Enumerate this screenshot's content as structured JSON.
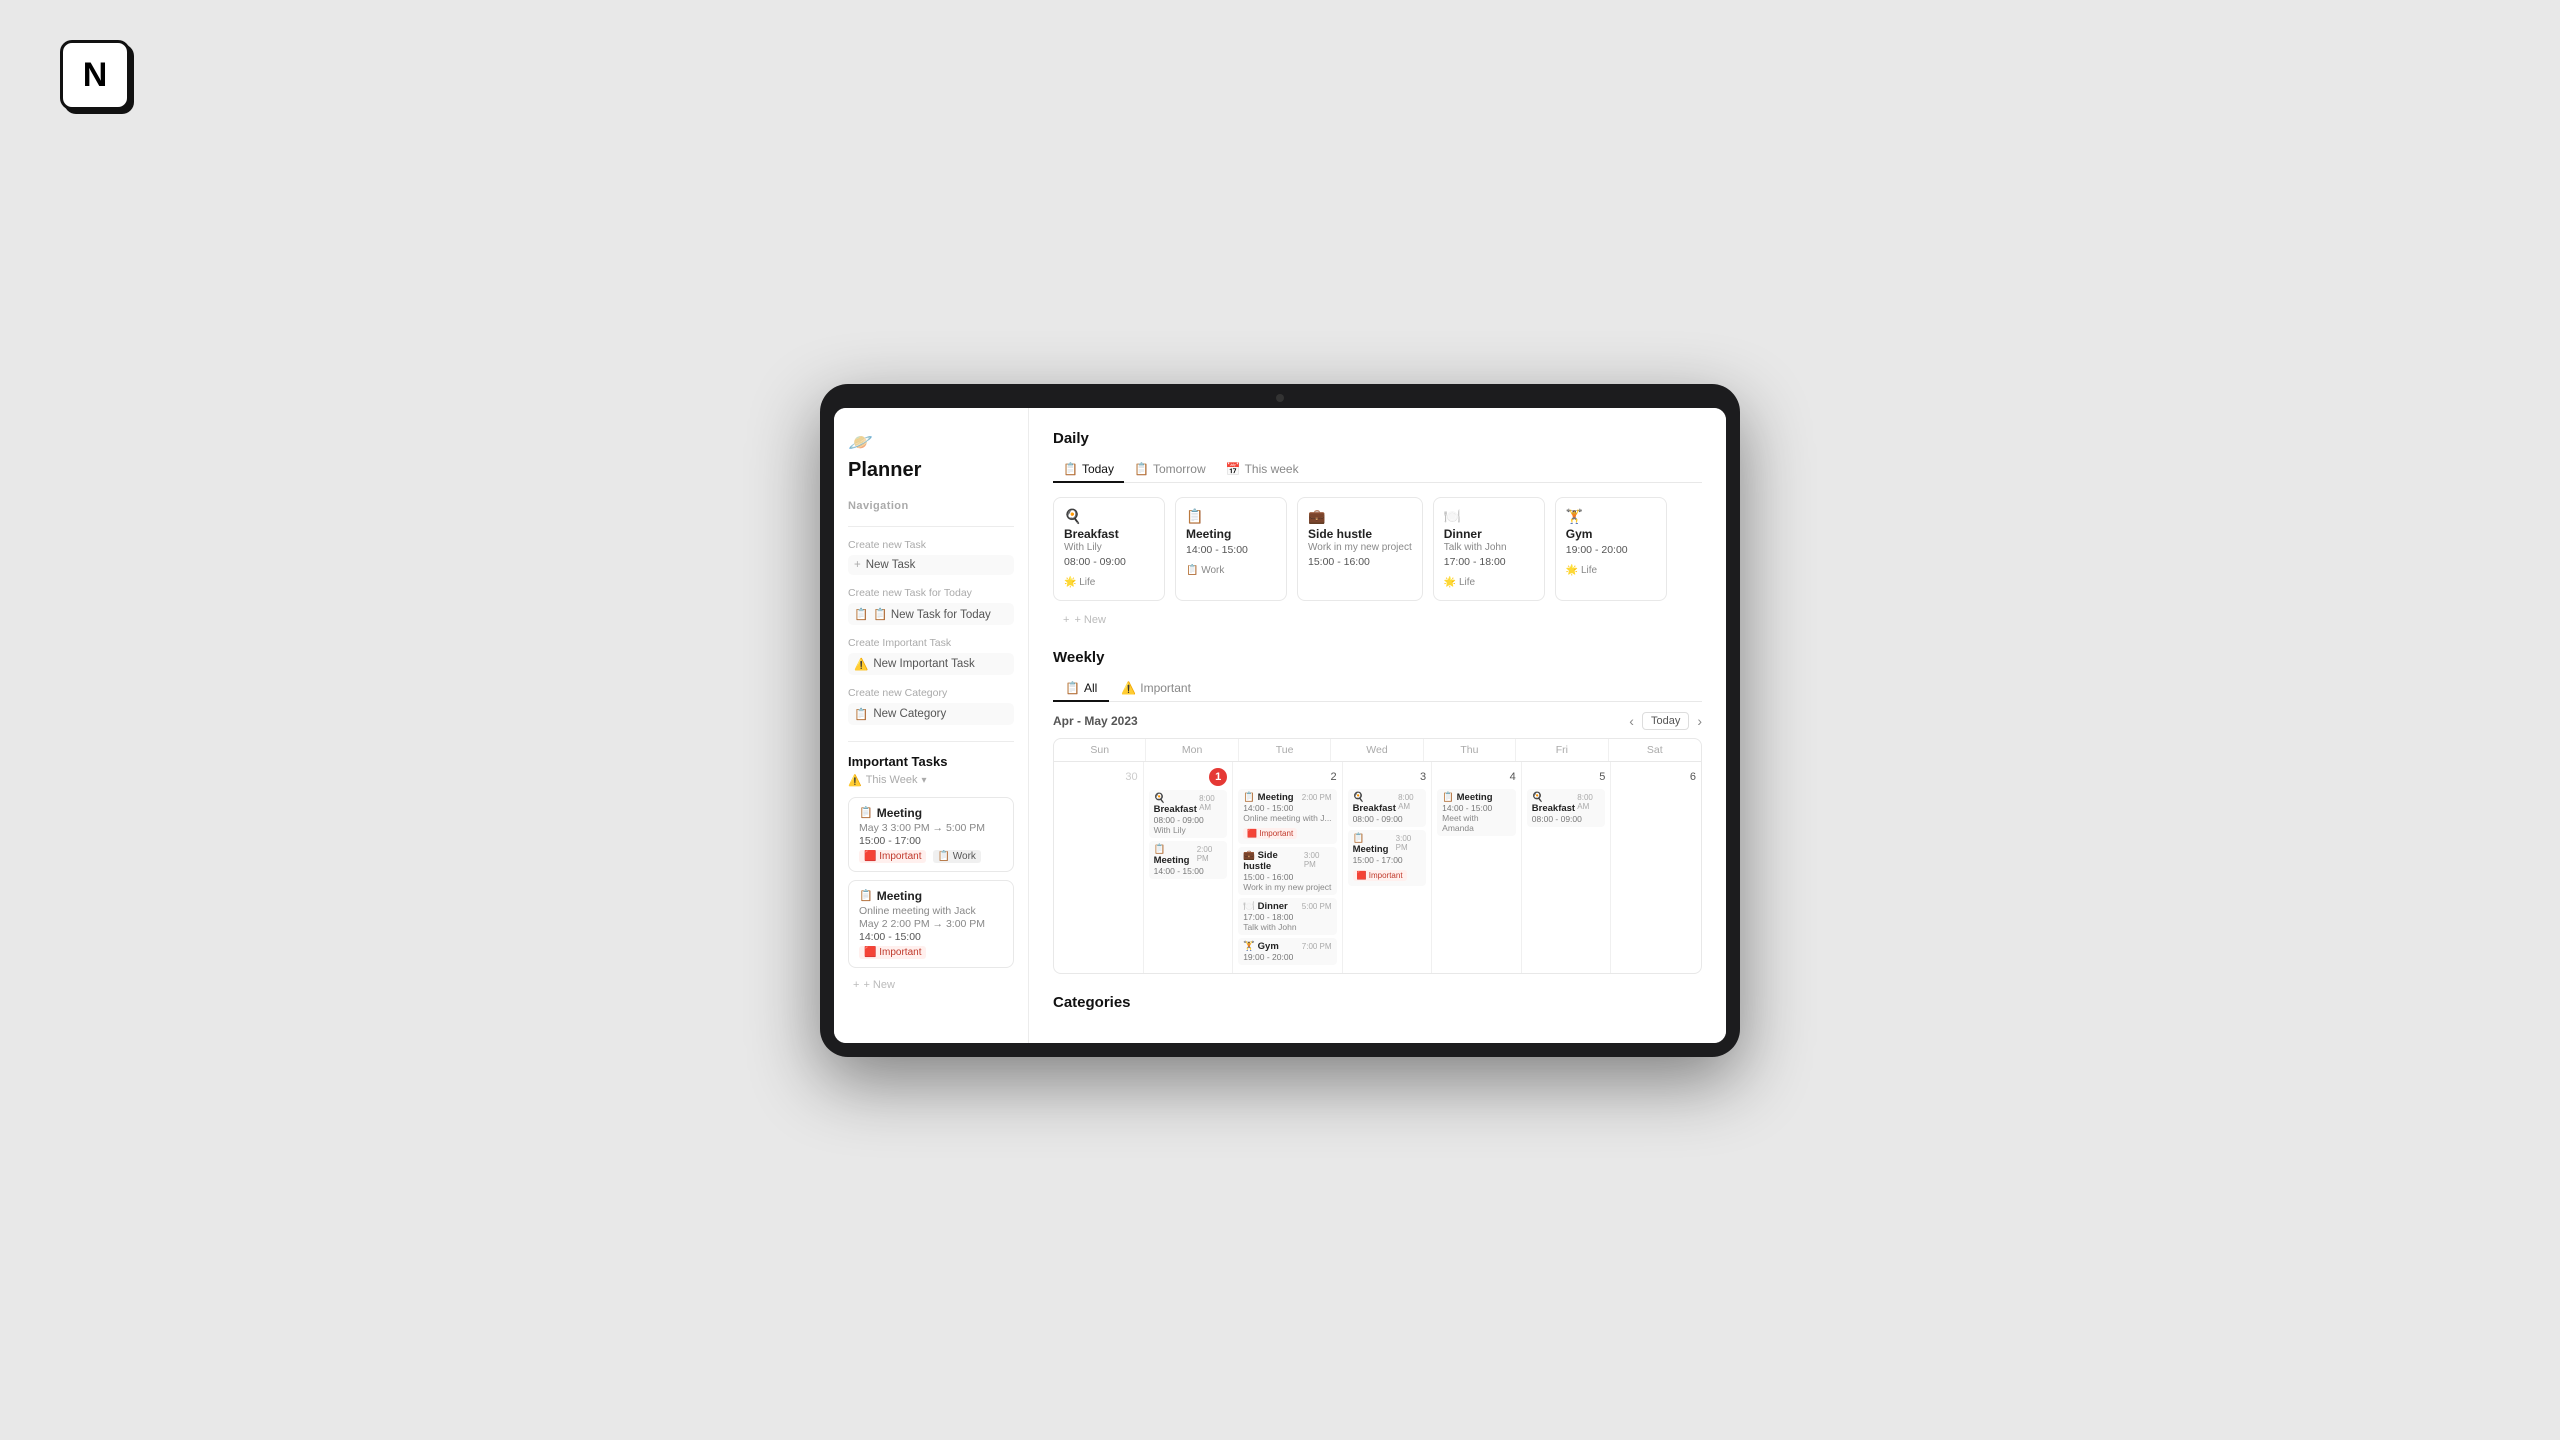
{
  "logo": "N",
  "planner": {
    "icon": "🪐",
    "title": "Planner"
  },
  "navigation": {
    "label": "Navigation"
  },
  "sidebar": {
    "sections": [
      {
        "label": "Create new Task",
        "button": "+ New Task"
      },
      {
        "label": "Create new Task for Today",
        "button": "📋 New Task for Today"
      },
      {
        "label": "Create Important Task",
        "button": "⚠️ New Important Task"
      },
      {
        "label": "Create new Category",
        "button": "📋 New Category"
      }
    ],
    "importantTasksTitle": "Important Tasks",
    "thisWeek": "This Week",
    "tasks": [
      {
        "emoji": "📋",
        "title": "Meeting",
        "date": "May 3 3:00 PM → 5:00 PM",
        "time": "15:00 - 17:00",
        "tags": [
          "Important",
          "Work"
        ]
      },
      {
        "emoji": "📋",
        "title": "Meeting",
        "date": "Online meeting with Jack",
        "date2": "May 2 2:00 PM → 3:00 PM",
        "time": "14:00 - 15:00",
        "tags": [
          "Important"
        ]
      }
    ],
    "newBtn": "+ New"
  },
  "daily": {
    "sectionTitle": "Daily",
    "tabs": [
      {
        "label": "📋 Today",
        "active": true
      },
      {
        "label": "📋 Tomorrow",
        "active": false
      },
      {
        "label": "📅 This week",
        "active": false
      }
    ],
    "cards": [
      {
        "emoji": "🍳",
        "name": "Breakfast",
        "sub": "With Lily",
        "time": "08:00 - 09:00",
        "tag": "🌟 Life",
        "tagType": "life"
      },
      {
        "emoji": "📋",
        "name": "Meeting",
        "sub": "",
        "time": "14:00 - 15:00",
        "tag": "📋 Work",
        "tagType": "work"
      },
      {
        "emoji": "💼",
        "name": "Side hustle",
        "sub": "Work in my new project",
        "time": "15:00 - 16:00",
        "tag": "",
        "tagType": ""
      },
      {
        "emoji": "🍽️",
        "name": "Dinner",
        "sub": "Talk with John",
        "time": "17:00 - 18:00",
        "tag": "🌟 Life",
        "tagType": "life"
      },
      {
        "emoji": "🏋️",
        "name": "Gym",
        "sub": "",
        "time": "19:00 - 20:00",
        "tag": "🌟 Life",
        "tagType": "life"
      }
    ],
    "newLabel": "+ New"
  },
  "weekly": {
    "sectionTitle": "Weekly",
    "tabs": [
      {
        "label": "📋 All",
        "active": true
      },
      {
        "label": "⚠️ Important",
        "active": false
      }
    ],
    "dateRange": "Apr - May 2023",
    "todayBtn": "Today",
    "dayHeaders": [
      "Sun",
      "Mon",
      "Tue",
      "Wed",
      "Thu",
      "Fri",
      "Sat"
    ],
    "days": [
      {
        "num": "30",
        "today": false,
        "events": []
      },
      {
        "num": "1",
        "today": true,
        "events": [
          {
            "emoji": "🍳",
            "name": "Breakfast",
            "timeLabel": "8:00 AM",
            "timeRange": "08:00 - 09:00",
            "sub": "With Lily",
            "tags": []
          },
          {
            "emoji": "📋",
            "name": "Meeting",
            "timeLabel": "2:00 PM",
            "timeRange": "14:00 - 15:00",
            "sub": "",
            "tags": []
          }
        ]
      },
      {
        "num": "2",
        "today": false,
        "events": [
          {
            "emoji": "📋",
            "name": "Meeting",
            "timeLabel": "2:00 PM",
            "timeRange": "14:00 - 15:00",
            "sub": "Online meeting with J...",
            "tags": [
              "Important"
            ]
          },
          {
            "emoji": "💼",
            "name": "Side hustle",
            "timeLabel": "3:00 PM",
            "timeRange": "15:00 - 16:00",
            "sub": "Work in my new project",
            "tags": []
          },
          {
            "emoji": "🍽️",
            "name": "Dinner",
            "timeLabel": "5:00 PM",
            "timeRange": "17:00 - 18:00",
            "sub": "Talk with John",
            "tags": []
          },
          {
            "emoji": "🏋️",
            "name": "Gym",
            "timeLabel": "7:00 PM",
            "timeRange": "19:00 - 20:00",
            "sub": "",
            "tags": []
          }
        ]
      },
      {
        "num": "3",
        "today": false,
        "events": [
          {
            "emoji": "🍳",
            "name": "Breakfast",
            "timeLabel": "8:00 AM",
            "timeRange": "08:00 - 09:00",
            "sub": "",
            "tags": []
          },
          {
            "emoji": "📋",
            "name": "Meeting",
            "timeLabel": "3:00 PM",
            "timeRange": "15:00 - 17:00",
            "sub": "",
            "tags": [
              "Important"
            ]
          }
        ]
      },
      {
        "num": "4",
        "today": false,
        "events": [
          {
            "emoji": "📋",
            "name": "Meeting",
            "timeLabel": "",
            "timeRange": "14:00 - 15:00",
            "sub": "Meet with Amanda",
            "tags": []
          }
        ]
      },
      {
        "num": "5",
        "today": false,
        "events": [
          {
            "emoji": "🍳",
            "name": "Breakfast",
            "timeLabel": "8:00 AM",
            "timeRange": "08:00 - 09:00",
            "sub": "",
            "tags": []
          }
        ]
      },
      {
        "num": "6",
        "today": false,
        "events": []
      }
    ]
  },
  "categories": {
    "sectionTitle": "Categories"
  }
}
